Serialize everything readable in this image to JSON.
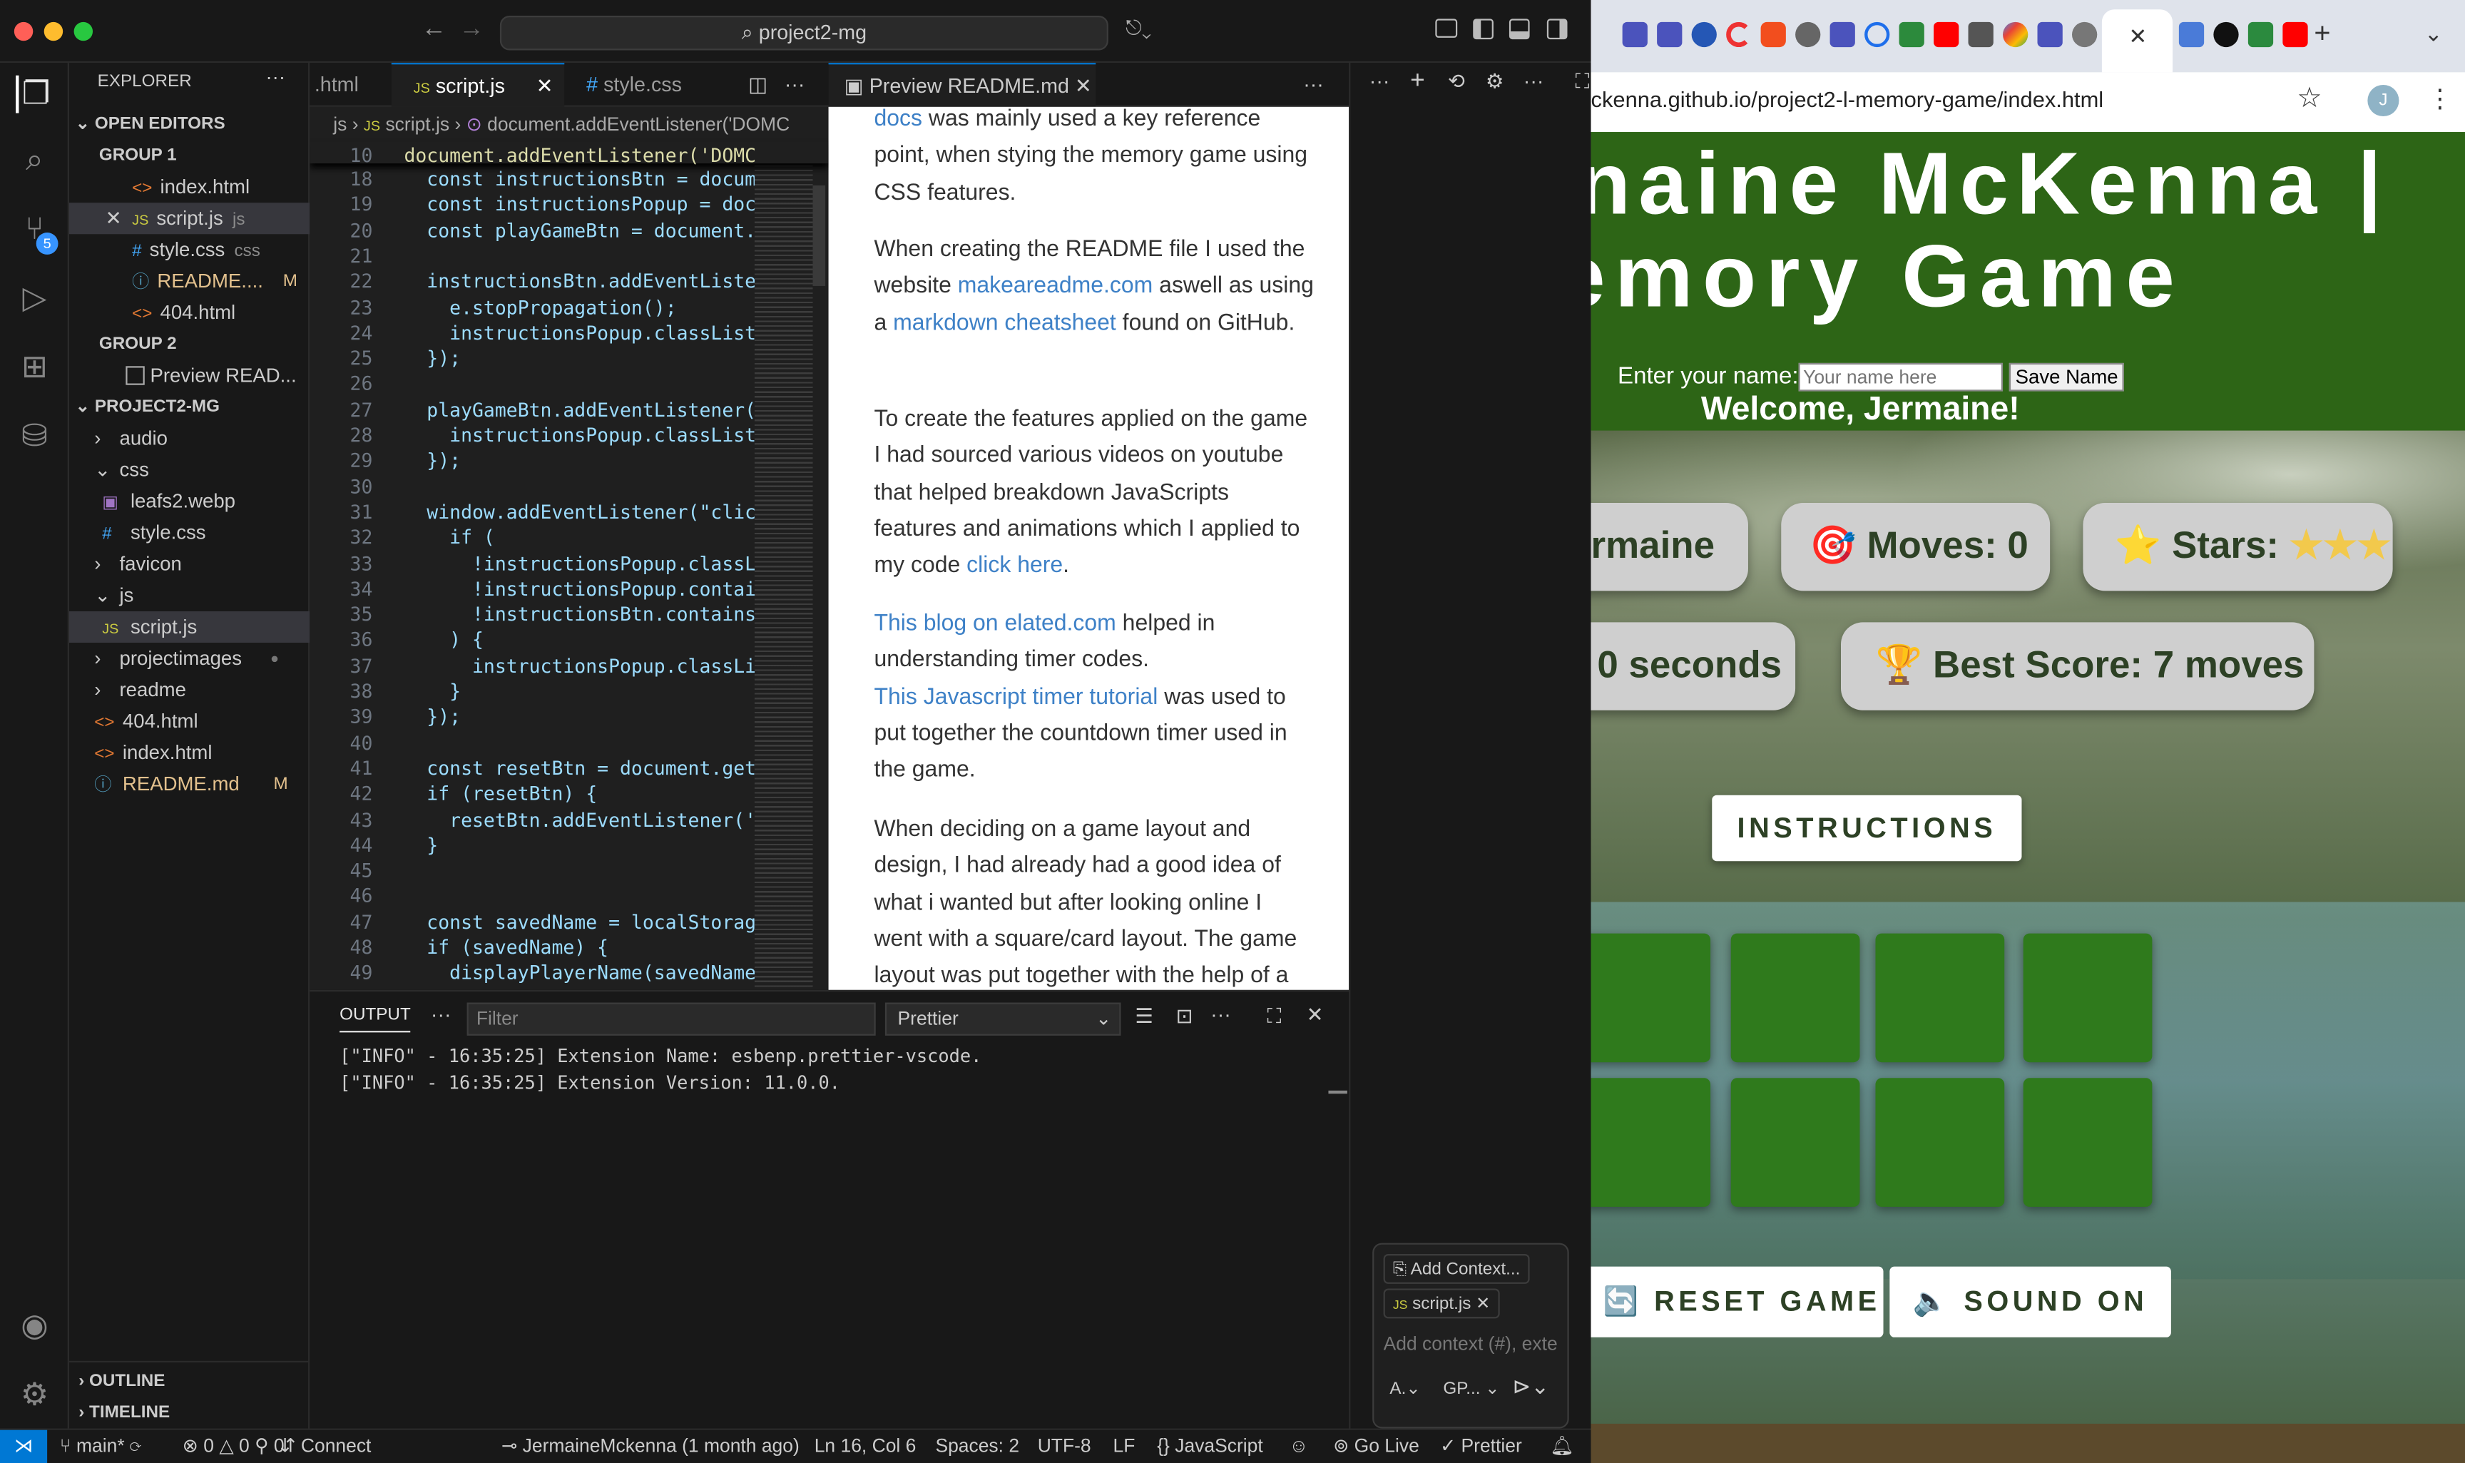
{
  "vscode": {
    "command_center": "project2-mg",
    "explorer": {
      "title": "EXPLORER",
      "open_editors": "OPEN EDITORS",
      "group1": "GROUP 1",
      "group1_files": [
        {
          "icon": "<>",
          "name": "index.html",
          "tag": ""
        },
        {
          "icon": "JS",
          "name": "script.js",
          "tag": "js"
        },
        {
          "icon": "#",
          "name": "style.css",
          "tag": "css"
        },
        {
          "icon": "ⓘ",
          "name": "README....",
          "tag": "M"
        },
        {
          "icon": "<>",
          "name": "404.html",
          "tag": ""
        }
      ],
      "group2": "GROUP 2",
      "group2_files": [
        {
          "name": "Preview READ..."
        }
      ],
      "project": "PROJECT2-MG",
      "tree": [
        {
          "type": "folder",
          "name": "audio",
          "depth": 1,
          "open": false
        },
        {
          "type": "folder",
          "name": "css",
          "depth": 1,
          "open": true
        },
        {
          "type": "file",
          "name": "leafs2.webp",
          "depth": 2,
          "icon": "▣"
        },
        {
          "type": "file",
          "name": "style.css",
          "depth": 2,
          "icon": "#"
        },
        {
          "type": "folder",
          "name": "favicon",
          "depth": 1,
          "open": false
        },
        {
          "type": "folder",
          "name": "js",
          "depth": 1,
          "open": true
        },
        {
          "type": "file",
          "name": "script.js",
          "depth": 2,
          "icon": "JS",
          "selected": true
        },
        {
          "type": "folder",
          "name": "projectimages",
          "depth": 1,
          "open": false
        },
        {
          "type": "folder",
          "name": "readme",
          "depth": 1,
          "open": false
        },
        {
          "type": "file",
          "name": "404.html",
          "depth": 1,
          "icon": "<>"
        },
        {
          "type": "file",
          "name": "index.html",
          "depth": 1,
          "icon": "<>"
        },
        {
          "type": "file",
          "name": "README.md",
          "depth": 1,
          "icon": "ⓘ",
          "tag": "M"
        }
      ],
      "outline": "OUTLINE",
      "timeline": "TIMELINE"
    },
    "tabs": [
      {
        "label": ".html",
        "icon": ""
      },
      {
        "label": "script.js",
        "icon": "JS"
      },
      {
        "label": "style.css",
        "icon": "#"
      }
    ],
    "preview_tab": "Preview README.md",
    "breadcrumb": [
      "js",
      "script.js",
      "document.addEventListener('DOMC"
    ],
    "code_lines": [
      {
        "n": "10",
        "t": "document.addEventListener('DOMCon"
      },
      {
        "n": "18",
        "t": "  const instructionsBtn = documen"
      },
      {
        "n": "19",
        "t": "  const instructionsPopup = docum"
      },
      {
        "n": "20",
        "t": "  const playGameBtn = document.ge"
      },
      {
        "n": "21",
        "t": ""
      },
      {
        "n": "22",
        "t": "  instructionsBtn.addEventListene"
      },
      {
        "n": "23",
        "t": "    e.stopPropagation();"
      },
      {
        "n": "24",
        "t": "    instructionsPopup.classList.t"
      },
      {
        "n": "25",
        "t": "  });"
      },
      {
        "n": "26",
        "t": ""
      },
      {
        "n": "27",
        "t": "  playGameBtn.addEventListener(\"c"
      },
      {
        "n": "28",
        "t": "    instructionsPopup.classList.a"
      },
      {
        "n": "29",
        "t": "  });"
      },
      {
        "n": "30",
        "t": ""
      },
      {
        "n": "31",
        "t": "  window.addEventListener(\"click\""
      },
      {
        "n": "32",
        "t": "    if ("
      },
      {
        "n": "33",
        "t": "      !instructionsPopup.classList"
      },
      {
        "n": "34",
        "t": "      !instructionsPopup.contains"
      },
      {
        "n": "35",
        "t": "      !instructionsBtn.contains(e"
      },
      {
        "n": "36",
        "t": "    ) {"
      },
      {
        "n": "37",
        "t": "      instructionsPopup.classList"
      },
      {
        "n": "38",
        "t": "    }"
      },
      {
        "n": "39",
        "t": "  });"
      },
      {
        "n": "40",
        "t": ""
      },
      {
        "n": "41",
        "t": "  const resetBtn = document.getEl"
      },
      {
        "n": "42",
        "t": "  if (resetBtn) {"
      },
      {
        "n": "43",
        "t": "    resetBtn.addEventListener('cl"
      },
      {
        "n": "44",
        "t": "  }"
      },
      {
        "n": "45",
        "t": ""
      },
      {
        "n": "46",
        "t": ""
      },
      {
        "n": "47",
        "t": "  const savedName = localStorage."
      },
      {
        "n": "48",
        "t": "  if (savedName) {"
      },
      {
        "n": "49",
        "t": "    displayPlayerName(savedName);"
      }
    ],
    "preview": {
      "p1_link": "docs",
      "p1_text": " was mainly used a key reference point, when stying the memory game using CSS features.",
      "p2_a": "When creating the README file I used the website ",
      "p2_link1": "makeareadme.com",
      "p2_b": " aswell as using a ",
      "p2_link2": "markdown cheatsheet",
      "p2_c": " found on GitHub.",
      "p3_text": "To create the features applied on the game I had sourced various videos on youtube that helped breakdown JavaScripts features and animations which I applied to my code ",
      "p3_link": "click here",
      "p4_link1": "This blog on elated.com",
      "p4_a": " helped in understanding timer codes.",
      "p4_link2": "This Javascript timer tutorial",
      "p4_b": " was used to put together the countdown timer used in the game.",
      "p5_text": "When deciding on a game layout and design, I had already had a good idea of what i wanted but after looking online I went with a square/card layout. The game layout was put together with the help of a"
    },
    "output": {
      "tab": "OUTPUT",
      "filter_placeholder": "Filter",
      "channel": "Prettier",
      "lines": [
        "[\"INFO\" - 16:35:25] Extension Name: esbenp.prettier-vscode.",
        "[\"INFO\" - 16:35:25] Extension Version: 11.0.0."
      ]
    },
    "chat": {
      "add_context_btn": "Add Context...",
      "chip": "script.js",
      "placeholder": "Add context (#), exte",
      "agent": "A.",
      "model": "GP..."
    },
    "status": {
      "branch": "main*",
      "errors": "0",
      "warnings": "0",
      "ports": "0",
      "connect": "Connect",
      "blame": "JermaineMckenna (1 month ago)",
      "position": "Ln 16, Col 6",
      "spaces": "Spaces: 2",
      "encoding": "UTF-8",
      "eol": "LF",
      "language": "JavaScript",
      "golive": "Go Live",
      "prettier": "Prettier"
    },
    "scm_badge": "5"
  },
  "browser": {
    "url": "ckenna.github.io/project2-l-memory-game/index.html",
    "avatar": "J",
    "page": {
      "title_line1": "naine McKenna |",
      "title_line2": "emory Game",
      "name_label": "Enter your name:",
      "name_placeholder": "Your name here",
      "save_btn": "Save Name",
      "welcome": "Welcome, Jermaine!",
      "player": "rmaine",
      "moves": "🎯 Moves: 0",
      "stars_label": "⭐ Stars: ",
      "stars": "★★★",
      "timer": "0 seconds",
      "best": "🏆 Best Score: 7 moves",
      "instructions": "INSTRUCTIONS",
      "reset": "🔄 RESET GAME",
      "sound": "🔈 SOUND ON"
    }
  }
}
